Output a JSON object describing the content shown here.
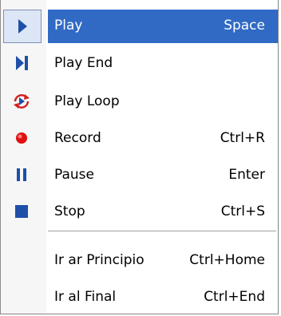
{
  "menu": {
    "items": [
      {
        "label": "Play",
        "shortcut": "Space",
        "icon": "play-icon",
        "selected": true
      },
      {
        "label": "Play End",
        "shortcut": "",
        "icon": "play-end-icon"
      },
      {
        "label": "Play Loop",
        "shortcut": "",
        "icon": "play-loop-icon"
      },
      {
        "label": "Record",
        "shortcut": "Ctrl+R",
        "icon": "record-icon"
      },
      {
        "label": "Pause",
        "shortcut": "Enter",
        "icon": "pause-icon"
      },
      {
        "label": "Stop",
        "shortcut": "Ctrl+S",
        "icon": "stop-icon"
      },
      {
        "label": "Ir ar Principio",
        "shortcut": "Ctrl+Home",
        "icon": ""
      },
      {
        "label": "Ir al Final",
        "shortcut": "Ctrl+End",
        "icon": ""
      }
    ]
  },
  "colors": {
    "highlight": "#316ac5",
    "play_blue": "#1f4fa8",
    "record_red": "#e01010"
  }
}
